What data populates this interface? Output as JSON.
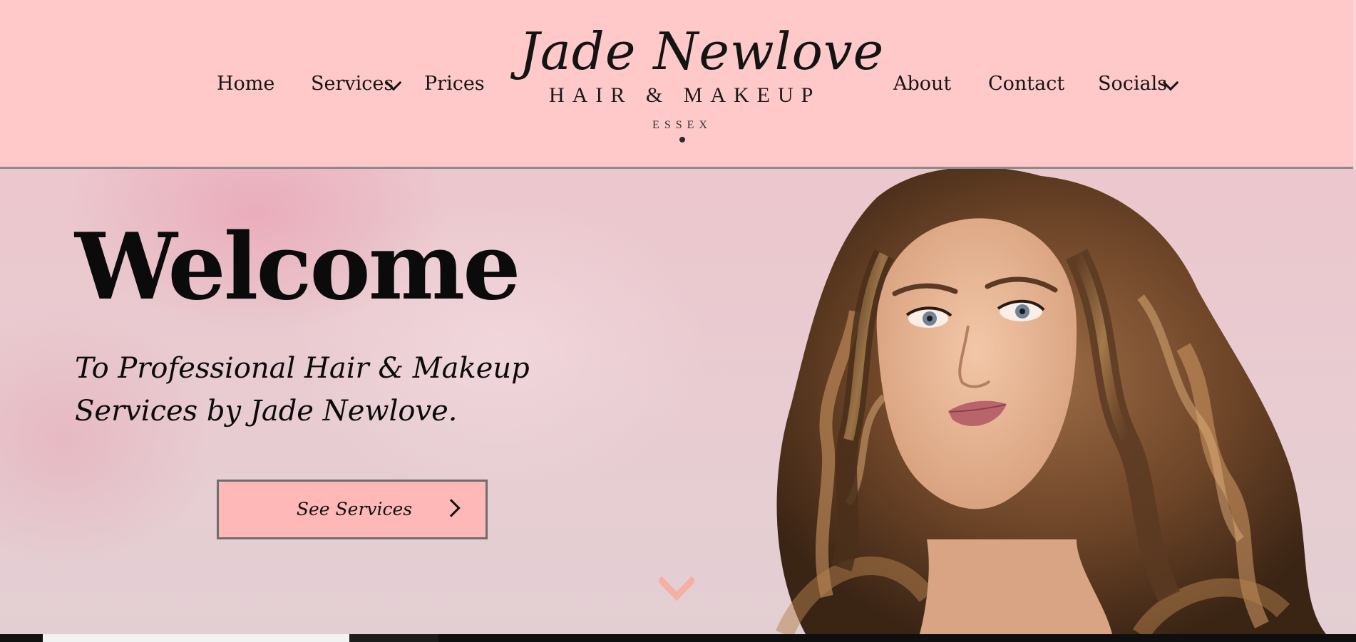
{
  "colors": {
    "header_bg": "#ffc9c9",
    "button_bg": "#ffb8b8",
    "scroll_chevron": "#f4b0a3",
    "text": "#0b0b0b"
  },
  "nav_left": [
    {
      "label": "Home",
      "has_dropdown": false
    },
    {
      "label": "Services",
      "has_dropdown": true
    },
    {
      "label": "Prices",
      "has_dropdown": false
    }
  ],
  "nav_right": [
    {
      "label": "About",
      "has_dropdown": false
    },
    {
      "label": "Contact",
      "has_dropdown": false
    },
    {
      "label": "Socials",
      "has_dropdown": true
    }
  ],
  "logo": {
    "name": "Jade Newlove",
    "subtitle": "HAIR & MAKEUP",
    "location": "ESSEX"
  },
  "hero": {
    "heading": "Welcome",
    "tagline": "To Professional Hair & Makeup Services by Jade Newlove.",
    "cta_label": "See Services",
    "cta_icon": "chevron-right-icon",
    "scroll_icon": "chevron-down-icon",
    "image": "woman-portrait-long-wavy-hair"
  }
}
